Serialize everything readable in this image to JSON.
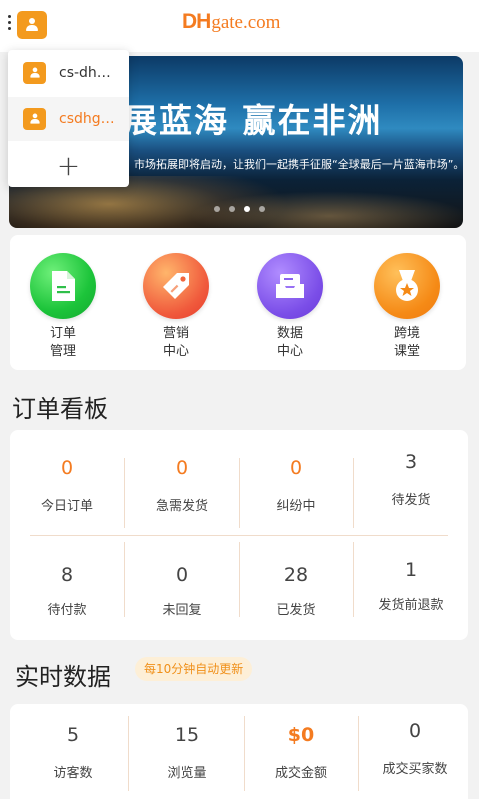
{
  "header": {
    "logo_dh": "DH",
    "logo_gate": "gate.com",
    "account_icon": "user-icon",
    "menu_icon": "kebab-menu-icon"
  },
  "account_menu": {
    "items": [
      {
        "label": "cs-dh…",
        "selected": false
      },
      {
        "label": "csdhg…",
        "selected": true
      }
    ],
    "add_label": "+"
  },
  "banner": {
    "title": "展蓝海  赢在非洲",
    "subtitle": "市场拓展即将启动，让我们一起携手征服“全球最后一片蓝海市场”。",
    "dot_count": 4,
    "active_dot": 2
  },
  "shortcuts": [
    {
      "label": "订单\n管理",
      "icon": "document-icon",
      "color": "#1cc43a"
    },
    {
      "label": "营销\n中心",
      "icon": "tag-icon",
      "color": "#f05a3c"
    },
    {
      "label": "数据\n中心",
      "icon": "inbox-icon",
      "color": "#7b4ee8"
    },
    {
      "label": "跨境\n课堂",
      "icon": "medal-icon",
      "color": "#f58a16"
    }
  ],
  "order_board": {
    "title": "订单看板",
    "cells": [
      {
        "value": "0",
        "label": "今日订单",
        "highlight": true
      },
      {
        "value": "0",
        "label": "急需发货",
        "highlight": true
      },
      {
        "value": "0",
        "label": "纠纷中",
        "highlight": true
      },
      {
        "value": "3",
        "label": "待发货",
        "highlight": false
      },
      {
        "value": "8",
        "label": "待付款",
        "highlight": false
      },
      {
        "value": "0",
        "label": "未回复",
        "highlight": false
      },
      {
        "value": "28",
        "label": "已发货",
        "highlight": false
      },
      {
        "value": "1",
        "label": "发货前退款",
        "highlight": false
      }
    ]
  },
  "realtime": {
    "title": "实时数据",
    "badge": "每10分钟自动更新",
    "cells": [
      {
        "value": "5",
        "label": "访客数",
        "highlight": false
      },
      {
        "value": "15",
        "label": "浏览量",
        "highlight": false
      },
      {
        "value": "$0",
        "label": "成交金额",
        "highlight": true
      },
      {
        "value": "0",
        "label": "成交买家数",
        "highlight": false
      }
    ]
  },
  "colors": {
    "accent": "#f47b20",
    "badge_bg": "#fdefd7",
    "badge_text": "#f0901a"
  }
}
